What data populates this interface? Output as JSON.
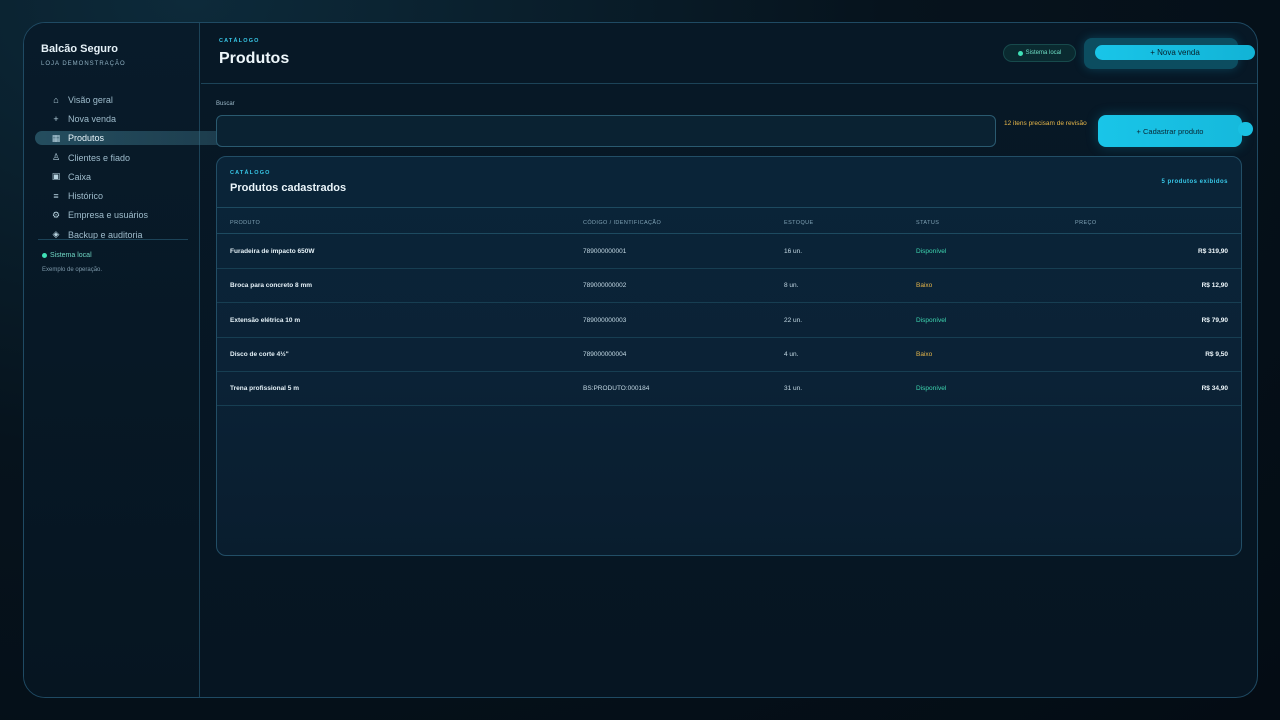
{
  "sidebar": {
    "brand": "Balcão Seguro",
    "store": "LOJA DEMONSTRAÇÃO",
    "items": [
      {
        "label": "Visão geral",
        "icon": "home-icon",
        "glyph": "⌂"
      },
      {
        "label": "Nova venda",
        "icon": "plus-icon",
        "glyph": "+"
      },
      {
        "label": "Produtos",
        "icon": "grid-icon",
        "glyph": "▦"
      },
      {
        "label": "Clientes e fiado",
        "icon": "user-icon",
        "glyph": "♙"
      },
      {
        "label": "Caixa",
        "icon": "register-icon",
        "glyph": "▣"
      },
      {
        "label": "Histórico",
        "icon": "list-icon",
        "glyph": "≡"
      },
      {
        "label": "Empresa e usuários",
        "icon": "gear-icon",
        "glyph": "⚙"
      },
      {
        "label": "Backup e auditoria",
        "icon": "diamond-icon",
        "glyph": "◈"
      }
    ],
    "active_index": 2,
    "status": "Sistema local",
    "note": "Exemplo de operação."
  },
  "header": {
    "eyebrow": "CATÁLOGO",
    "title": "Produtos",
    "status": "Sistema local",
    "new_sale": "+ Nova venda"
  },
  "search": {
    "label": "Buscar",
    "value": "",
    "review_notice": "12 itens precisam de revisão",
    "register_button": "+ Cadastrar produto"
  },
  "panel": {
    "eyebrow": "CATÁLOGO",
    "title": "Produtos cadastrados",
    "count": "5 produtos exibidos",
    "columns": [
      "PRODUTO",
      "CÓDIGO / IDENTIFICAÇÃO",
      "ESTOQUE",
      "STATUS",
      "PREÇO"
    ],
    "rows": [
      {
        "product": "Furadeira de impacto 650W",
        "code": "789000000001",
        "stock": "16 un.",
        "status": "Disponível",
        "price": "R$ 319,90"
      },
      {
        "product": "Broca para concreto 8 mm",
        "code": "789000000002",
        "stock": "8 un.",
        "status": "Baixo",
        "price": "R$ 12,90"
      },
      {
        "product": "Extensão elétrica 10 m",
        "code": "789000000003",
        "stock": "22 un.",
        "status": "Disponível",
        "price": "R$ 79,90"
      },
      {
        "product": "Disco de corte 4½\"",
        "code": "789000000004",
        "stock": "4 un.",
        "status": "Baixo",
        "price": "R$ 9,50"
      },
      {
        "product": "Trena profissional 5 m",
        "code": "BS:PRODUTO:000184",
        "stock": "31 un.",
        "status": "Disponível",
        "price": "R$ 34,90"
      }
    ]
  },
  "colors": {
    "accent": "#19c5e8",
    "ok": "#3ed6b0",
    "warn": "#e6b64a",
    "background": "#061522"
  }
}
